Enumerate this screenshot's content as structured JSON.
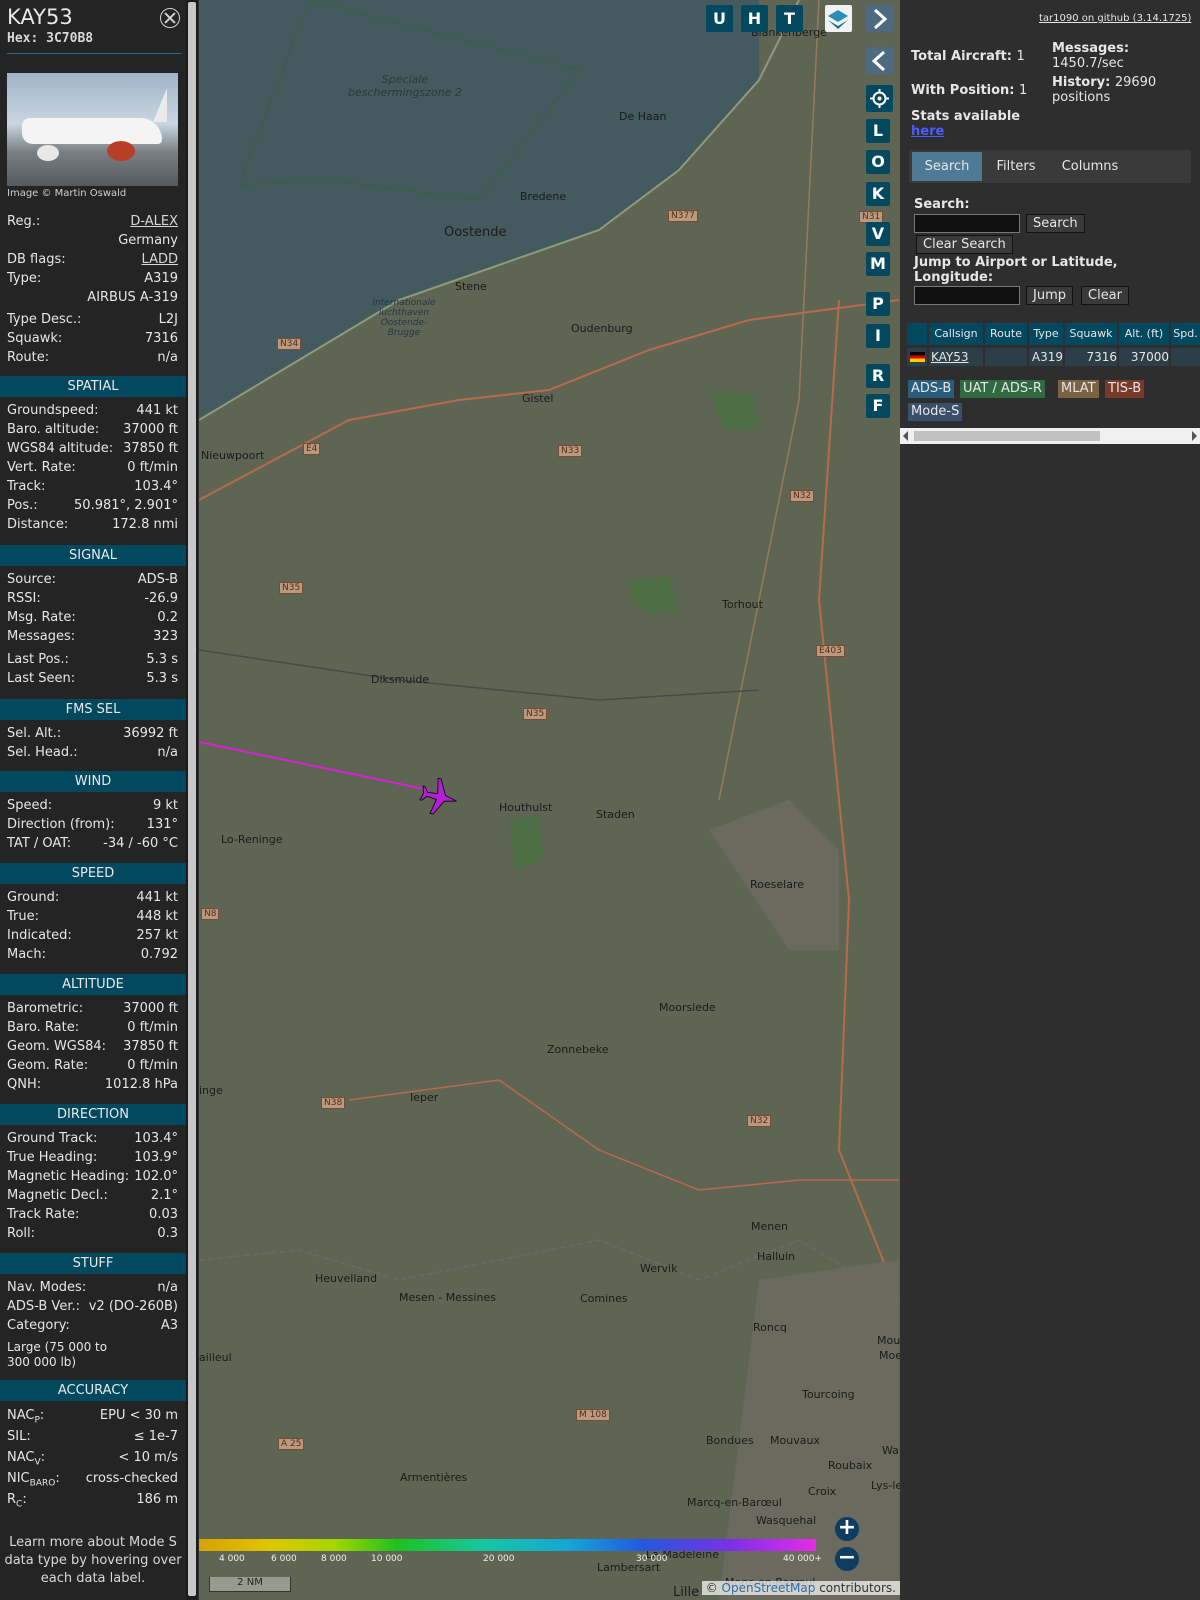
{
  "aircraft": {
    "callsign": "KAY53",
    "hex": "Hex: 3C70B8",
    "image_credit": "Image © Martin Oswald",
    "registration": {
      "label": "Reg.:",
      "value": "D-ALEX",
      "country": "Germany"
    },
    "db_flags": {
      "label": "DB flags:",
      "value": "LADD"
    },
    "type": {
      "label": "Type:",
      "value": "A319",
      "name": "AIRBUS A-319"
    },
    "type_desc": {
      "label": "Type Desc.:",
      "value": "L2J"
    },
    "squawk": {
      "label": "Squawk:",
      "value": "7316"
    },
    "route": {
      "label": "Route:",
      "value": "n/a"
    }
  },
  "sections": {
    "spatial": {
      "title": "SPATIAL",
      "rows": [
        {
          "label": "Groundspeed:",
          "value": "441 kt"
        },
        {
          "label": "Baro. altitude:",
          "value": "37000 ft"
        },
        {
          "label": "WGS84 altitude:",
          "value": "37850 ft"
        },
        {
          "label": "Vert. Rate:",
          "value": "0 ft/min"
        },
        {
          "label": "Track:",
          "value": "103.4°"
        },
        {
          "label": "Pos.:",
          "value": "50.981°, 2.901°"
        },
        {
          "label": "Distance:",
          "value": "172.8 nmi"
        }
      ]
    },
    "signal": {
      "title": "SIGNAL",
      "rows": [
        {
          "label": "Source:",
          "value": "ADS-B"
        },
        {
          "label": "RSSI:",
          "value": "-26.9"
        },
        {
          "label": "Msg. Rate:",
          "value": "0.2"
        },
        {
          "label": "Messages:",
          "value": "323"
        },
        {
          "label": "Last Pos.:",
          "value": "5.3 s"
        },
        {
          "label": "Last Seen:",
          "value": "5.3 s"
        }
      ]
    },
    "fms": {
      "title": "FMS SEL",
      "rows": [
        {
          "label": "Sel. Alt.:",
          "value": "36992 ft"
        },
        {
          "label": "Sel. Head.:",
          "value": "n/a"
        }
      ]
    },
    "wind": {
      "title": "WIND",
      "rows": [
        {
          "label": "Speed:",
          "value": "9 kt"
        },
        {
          "label": "Direction (from):",
          "value": "131°"
        },
        {
          "label": "TAT / OAT:",
          "value": "-34 / -60 °C"
        }
      ]
    },
    "speed": {
      "title": "SPEED",
      "rows": [
        {
          "label": "Ground:",
          "value": "441 kt"
        },
        {
          "label": "True:",
          "value": "448 kt"
        },
        {
          "label": "Indicated:",
          "value": "257 kt"
        },
        {
          "label": "Mach:",
          "value": "0.792"
        }
      ]
    },
    "altitude": {
      "title": "ALTITUDE",
      "rows": [
        {
          "label": "Barometric:",
          "value": "37000 ft"
        },
        {
          "label": "Baro. Rate:",
          "value": "0 ft/min"
        },
        {
          "label": "Geom. WGS84:",
          "value": "37850 ft"
        },
        {
          "label": "Geom. Rate:",
          "value": "0 ft/min"
        },
        {
          "label": "QNH:",
          "value": "1012.8 hPa"
        }
      ]
    },
    "direction": {
      "title": "DIRECTION",
      "rows": [
        {
          "label": "Ground Track:",
          "value": "103.4°"
        },
        {
          "label": "True Heading:",
          "value": "103.9°"
        },
        {
          "label": "Magnetic Heading:",
          "value": "102.0°"
        },
        {
          "label": "Magnetic Decl.:",
          "value": "2.1°"
        },
        {
          "label": "Track Rate:",
          "value": "0.03"
        },
        {
          "label": "Roll:",
          "value": "0.3"
        }
      ]
    },
    "stuff": {
      "title": "STUFF",
      "rows": [
        {
          "label": "Nav. Modes:",
          "value": "n/a"
        },
        {
          "label": "ADS-B Ver.:",
          "value": "v2 (DO-260B)"
        },
        {
          "label": "Category:",
          "value": "A3"
        }
      ],
      "category_desc": "Large (75 000 to 300 000 lb)"
    },
    "accuracy": {
      "title": "ACCURACY",
      "rows": [
        {
          "label": "NAC",
          "sub": "P",
          "tail": ":",
          "value": "EPU < 30 m"
        },
        {
          "label": "SIL:",
          "sub": "",
          "tail": "",
          "value": "≤ 1e-7"
        },
        {
          "label": "NAC",
          "sub": "V",
          "tail": ":",
          "value": "< 10 m/s"
        },
        {
          "label": "NIC",
          "sub": "BARO",
          "tail": ":",
          "value": "cross-checked"
        },
        {
          "label": "R",
          "sub": "C",
          "tail": ":",
          "value": "186 m"
        }
      ]
    },
    "footer": "Learn more about Mode S data type by hovering over each data label."
  },
  "map": {
    "labels": {
      "zone": "Speciale beschermingszone 2",
      "airport": "Internationale luchthaven Oostende-Brugge",
      "blankenberge": "Blankenberge",
      "dehaan": "De Haan",
      "bredene": "Bredene",
      "oostende": "Oostende",
      "stene": "Stene",
      "oudenburg": "Oudenburg",
      "gistel": "Gistel",
      "nieuwpoort": "Nieuwpoort",
      "torhout": "Torhout",
      "diksmuide": "Diksmuide",
      "houthulst": "Houthulst",
      "staden": "Staden",
      "loreninge": "Lo-Reninge",
      "roeselare": "Roeselare",
      "moorslede": "Moorslede",
      "zonnebeke": "Zonnebeke",
      "ieper": "Ieper",
      "inge": "inge",
      "menen": "Menen",
      "halluin": "Halluin",
      "wervik": "Wervik",
      "comines": "Comines",
      "heuvelland": "Heuvelland",
      "mesen": "Mesen - Messines",
      "roncq": "Roncq",
      "ailleul": "ailleul",
      "tourcoing": "Tourcoing",
      "bondues": "Bondues",
      "mouvaux": "Mouvaux",
      "roubaix": "Roubaix",
      "croix": "Croix",
      "armentieres": "Armentières",
      "marcq": "Marcq-en-Barœul",
      "wasquehal": "Wasquehal",
      "lysle": "Lys-le",
      "lambersart": "Lambersart",
      "lamadeleine": "La Madeleine",
      "mons": "Mons-en-Barœul",
      "lille": "Lille",
      "mou": "Mou",
      "moe": "Moe",
      "wa": "Wa"
    },
    "roads": [
      "N377",
      "N31",
      "N34",
      "N33",
      "N32",
      "N35",
      "E403",
      "N35",
      "N8",
      "N38",
      "N32",
      "M 108",
      "A 25",
      "E4"
    ],
    "toolbar": [
      "U",
      "H",
      "T"
    ],
    "side_buttons": [
      "L",
      "O",
      "K",
      "V",
      "M",
      "P",
      "I",
      "R",
      "F"
    ],
    "zoom_in": "+",
    "zoom_out": "−",
    "scale": "2 NM",
    "attribution_prefix": "©",
    "attribution_link": "OpenStreetMap",
    "attribution_suffix": "contributors.",
    "altitude_ticks": [
      "4 000",
      "6 000",
      "8 000",
      "10 000",
      "20 000",
      "30 000",
      "40 000+"
    ]
  },
  "right": {
    "version": "tar1090 on github (3.14.1725)",
    "total_aircraft_label": "Total Aircraft:",
    "total_aircraft": "1",
    "with_position_label": "With Position:",
    "with_position": "1",
    "messages_label": "Messages:",
    "messages": "1450.7/sec",
    "history_label": "History:",
    "history": "29690 positions",
    "stats_label": "Stats available",
    "stats_link": "here",
    "tabs": [
      "Search",
      "Filters",
      "Columns"
    ],
    "search_label": "Search:",
    "search_button": "Search",
    "clear_search_button": "Clear Search",
    "jump_label": "Jump to Airport or Latitude, Longitude:",
    "jump_button": "Jump",
    "clear_button": "Clear",
    "table": {
      "columns": [
        "",
        "Callsign",
        "Route",
        "Type",
        "Squawk",
        "Alt. (ft)",
        "Spd."
      ],
      "row": {
        "callsign": "KAY53",
        "route": "",
        "type": "A319",
        "squawk": "7316",
        "alt": "37000"
      }
    },
    "sources": [
      "ADS-B",
      "UAT / ADS-R",
      "MLAT",
      "TIS-B",
      "Mode-S"
    ]
  }
}
